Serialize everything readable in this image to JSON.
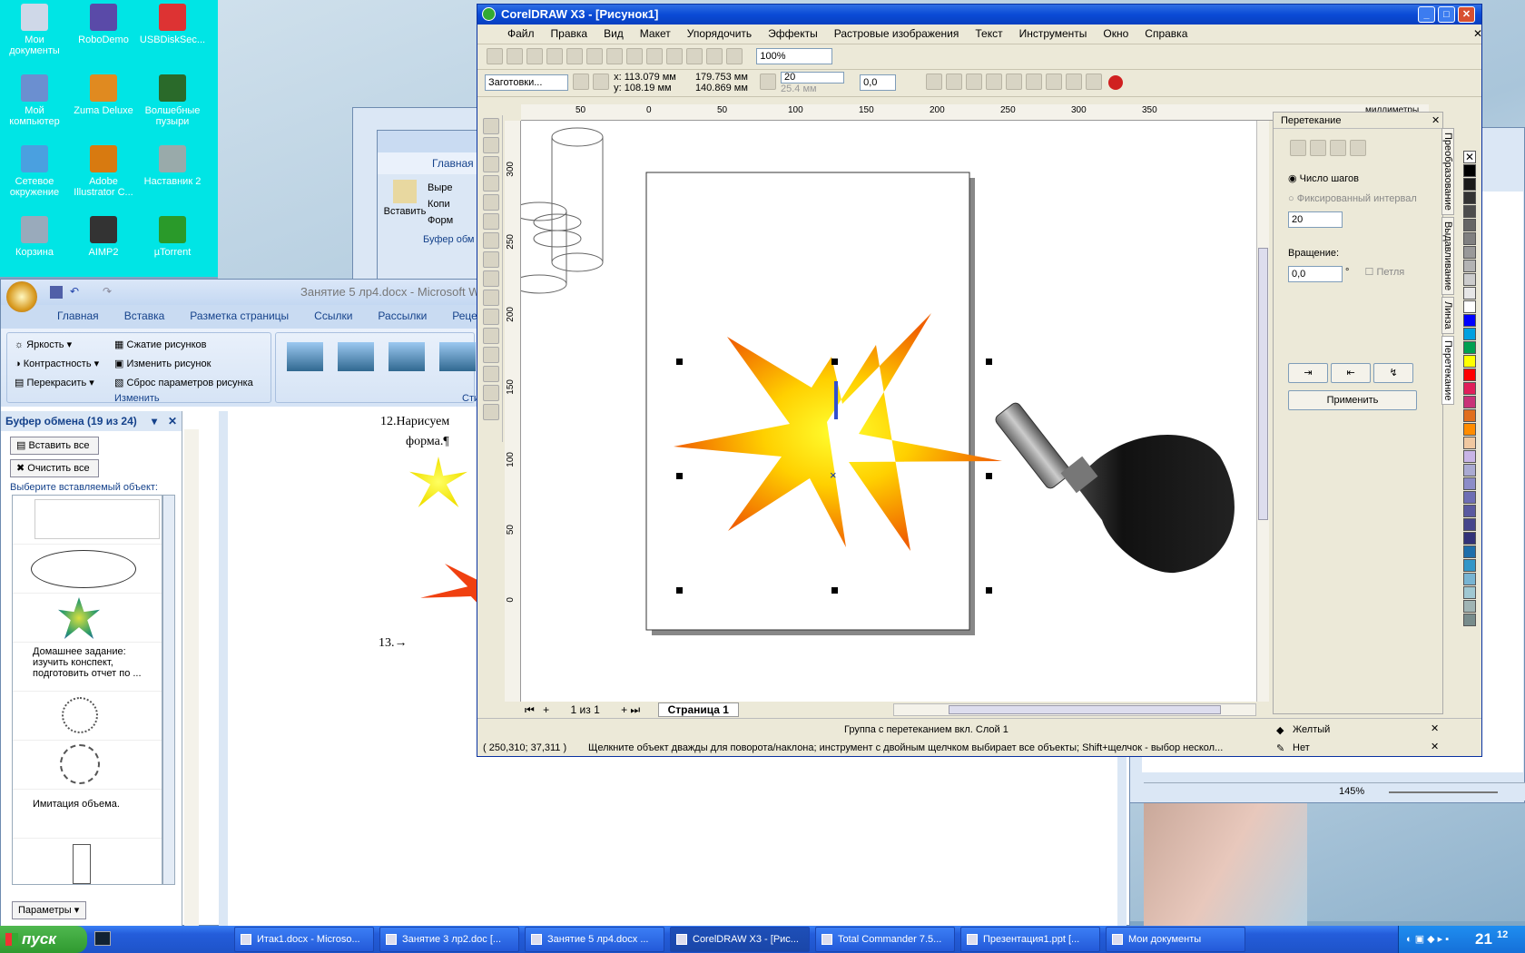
{
  "desktop": {
    "icons": [
      {
        "label": "Мои документы",
        "color": "#cfd8e8"
      },
      {
        "label": "RoboDemo",
        "color": "#5a4aa8"
      },
      {
        "label": "USBDiskSec...",
        "color": "#d33"
      },
      {
        "label": "Мой компьютер",
        "color": "#6b8fd0"
      },
      {
        "label": "Zuma Deluxe",
        "color": "#e08a20"
      },
      {
        "label": "Волшебные пузыри",
        "color": "#2a6a2a"
      },
      {
        "label": "Сетевое окружение",
        "color": "#4aa0e0"
      },
      {
        "label": "Adobe Illustrator C...",
        "color": "#d87a10"
      },
      {
        "label": "Наставник 2",
        "color": "#9aa"
      },
      {
        "label": "Корзина",
        "color": "#9ab"
      },
      {
        "label": "AIMP2",
        "color": "#333"
      },
      {
        "label": "µTorrent",
        "color": "#2a9a2a"
      }
    ]
  },
  "word": {
    "title": "Занятие 5 лр4.docx - Microsoft W",
    "tabs": [
      "Главная",
      "Вставка",
      "Разметка страницы",
      "Ссылки",
      "Рассылки",
      "Реценз"
    ],
    "adjust": {
      "brightness": "Яркость",
      "compress": "Сжатие рисунков",
      "contrast": "Контрастность",
      "change": "Изменить рисунок",
      "recolor": "Перекрасить",
      "reset": "Сброс параметров рисунка",
      "group": "Изменить",
      "styles": "Сти"
    },
    "clip_title": "Буфер обмена (19 из 24)",
    "paste_all": "Вставить все",
    "clear_all": "Очистить все",
    "choose": "Выберите вставляемый объект:",
    "item_hw": "Домашнее задание: изучить конспект, подготовить отчет по ...",
    "item_volume": "Имитация объема.",
    "params": "Параметры",
    "doc_line1": "12.Нарисуем",
    "doc_line2": "форма.¶",
    "doc_line3": "13.→",
    "back_tab": "Главная",
    "back_paste": "Вставить",
    "back_cut": "Выре",
    "back_copy": "Копи",
    "back_format": "Форм",
    "back_buffer": "Буфер обм",
    "zoom": "145%"
  },
  "corel": {
    "title": "CorelDRAW X3 - [Рисунок1]",
    "menu": [
      "Файл",
      "Правка",
      "Вид",
      "Макет",
      "Упорядочить",
      "Эффекты",
      "Растровые изображения",
      "Текст",
      "Инструменты",
      "Окно",
      "Справка"
    ],
    "zoom": "100%",
    "presets": "Заготовки...",
    "x": "x: 113.079 мм",
    "y": "y: 108.19 мм",
    "w": "179.753 мм",
    "h": "140.869 мм",
    "steps_box": "20",
    "step2": "25.4 мм",
    "angle": "0,0",
    "ruler_unit": "миллиметры",
    "ruler_h": [
      "50",
      "0",
      "50",
      "100",
      "150",
      "200",
      "250",
      "300",
      "350"
    ],
    "ruler_v": [
      "300",
      "250",
      "200",
      "150",
      "100",
      "50",
      "0"
    ],
    "pages": "1 из 1",
    "page_tab": "Страница 1",
    "status1": "Группа с перетеканием вкл. Слой 1",
    "coords": "( 250,310; 37,311 )",
    "hint": "Щелкните объект дважды для поворота/наклона; инструмент с двойным щелчком выбирает все объекты; Shift+щелчок - выбор нескол...",
    "fill_label": "Желтый",
    "outline_label": "Нет",
    "docker": {
      "title": "Перетекание",
      "steps_label": "Число шагов",
      "fixed_label": "Фиксированный интервал",
      "steps": "20",
      "rotation_label": "Вращение:",
      "rotation": "0,0",
      "loop": "Петля",
      "apply": "Применить",
      "tabs": [
        "Преобразование",
        "Выдавливание",
        "Линза",
        "Перетекание"
      ]
    },
    "palette": [
      "#000000",
      "#1a1a1a",
      "#333333",
      "#4d4d4d",
      "#666666",
      "#808080",
      "#999999",
      "#b3b3b3",
      "#cccccc",
      "#e6e6e6",
      "#ffffff",
      "#0000ff",
      "#00a0e0",
      "#00a050",
      "#ffff00",
      "#ff0000",
      "#e01e5a",
      "#c83278",
      "#e06e1e",
      "#ff8c00",
      "#f0c8a0",
      "#c8b4e6",
      "#aaaad2",
      "#8c8cc8",
      "#6e6eb4",
      "#5a5aa0",
      "#46468c",
      "#323278",
      "#1e6eaa",
      "#3296c8",
      "#78b4d2",
      "#a0c8d2",
      "#a0b4b4",
      "#788c8c"
    ]
  },
  "taskbar": {
    "start": "пуск",
    "items": [
      "Итак1.docx - Microso...",
      "Занятие 3 лр2.doc [...",
      "Занятие 5 лр4.docx ...",
      "CorelDRAW X3 - [Рис...",
      "Total Commander 7.5...",
      "Презентация1.ppt [...",
      "Мои документы"
    ],
    "clock": "21",
    "clock_min": "12"
  }
}
